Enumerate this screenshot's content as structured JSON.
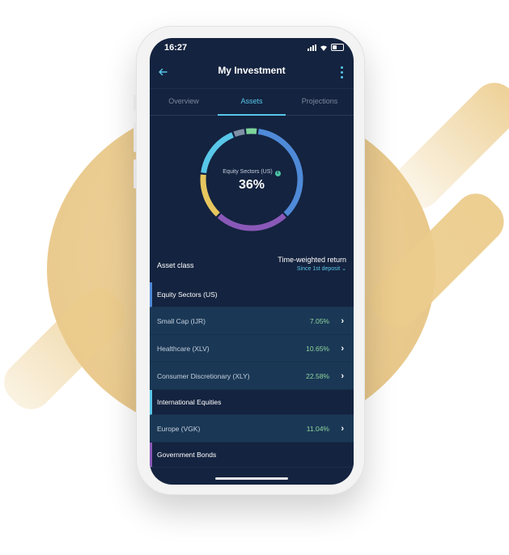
{
  "status": {
    "time": "16:27"
  },
  "header": {
    "title": "My Investment"
  },
  "tabs": [
    {
      "label": "Overview",
      "active": false
    },
    {
      "label": "Assets",
      "active": true
    },
    {
      "label": "Projections",
      "active": false
    }
  ],
  "donut": {
    "label": "Equity Sectors (US)",
    "value": "36%",
    "segments": [
      {
        "name": "Equity Sectors (US)",
        "color": "#4f8ad8",
        "fraction": 0.36
      },
      {
        "name": "Government Bonds",
        "color": "#8a59b8",
        "fraction": 0.24
      },
      {
        "name": "Other (yellow)",
        "color": "#e7c65f",
        "fraction": 0.15
      },
      {
        "name": "International Equities",
        "color": "#58c7e9",
        "fraction": 0.17
      },
      {
        "name": "Other (gray)",
        "color": "#8090a6",
        "fraction": 0.04
      },
      {
        "name": "Other (green)",
        "color": "#7ed49b",
        "fraction": 0.04
      }
    ]
  },
  "asset_header": {
    "left": "Asset class",
    "right_title": "Time-weighted return",
    "right_sub": "Since 1st deposit"
  },
  "groups": [
    {
      "name": "Equity Sectors (US)",
      "items": [
        {
          "name": "Small Cap (IJR)",
          "pct": "7.05%"
        },
        {
          "name": "Healthcare (XLV)",
          "pct": "10.65%"
        },
        {
          "name": "Consumer Discretionary (XLY)",
          "pct": "22.58%"
        }
      ]
    },
    {
      "name": "International Equities",
      "items": [
        {
          "name": "Europe (VGK)",
          "pct": "11.04%"
        }
      ]
    },
    {
      "name": "Government Bonds",
      "items": []
    }
  ],
  "colors": {
    "background_accent": "#e9c98c",
    "screen_bg": "#14233f",
    "accent": "#58c7e9",
    "positive": "#8fd49a"
  },
  "icons": {
    "back": "arrow-left-icon",
    "more": "more-vertical-icon",
    "chevron": "chevron-right-icon",
    "info": "info-icon"
  }
}
